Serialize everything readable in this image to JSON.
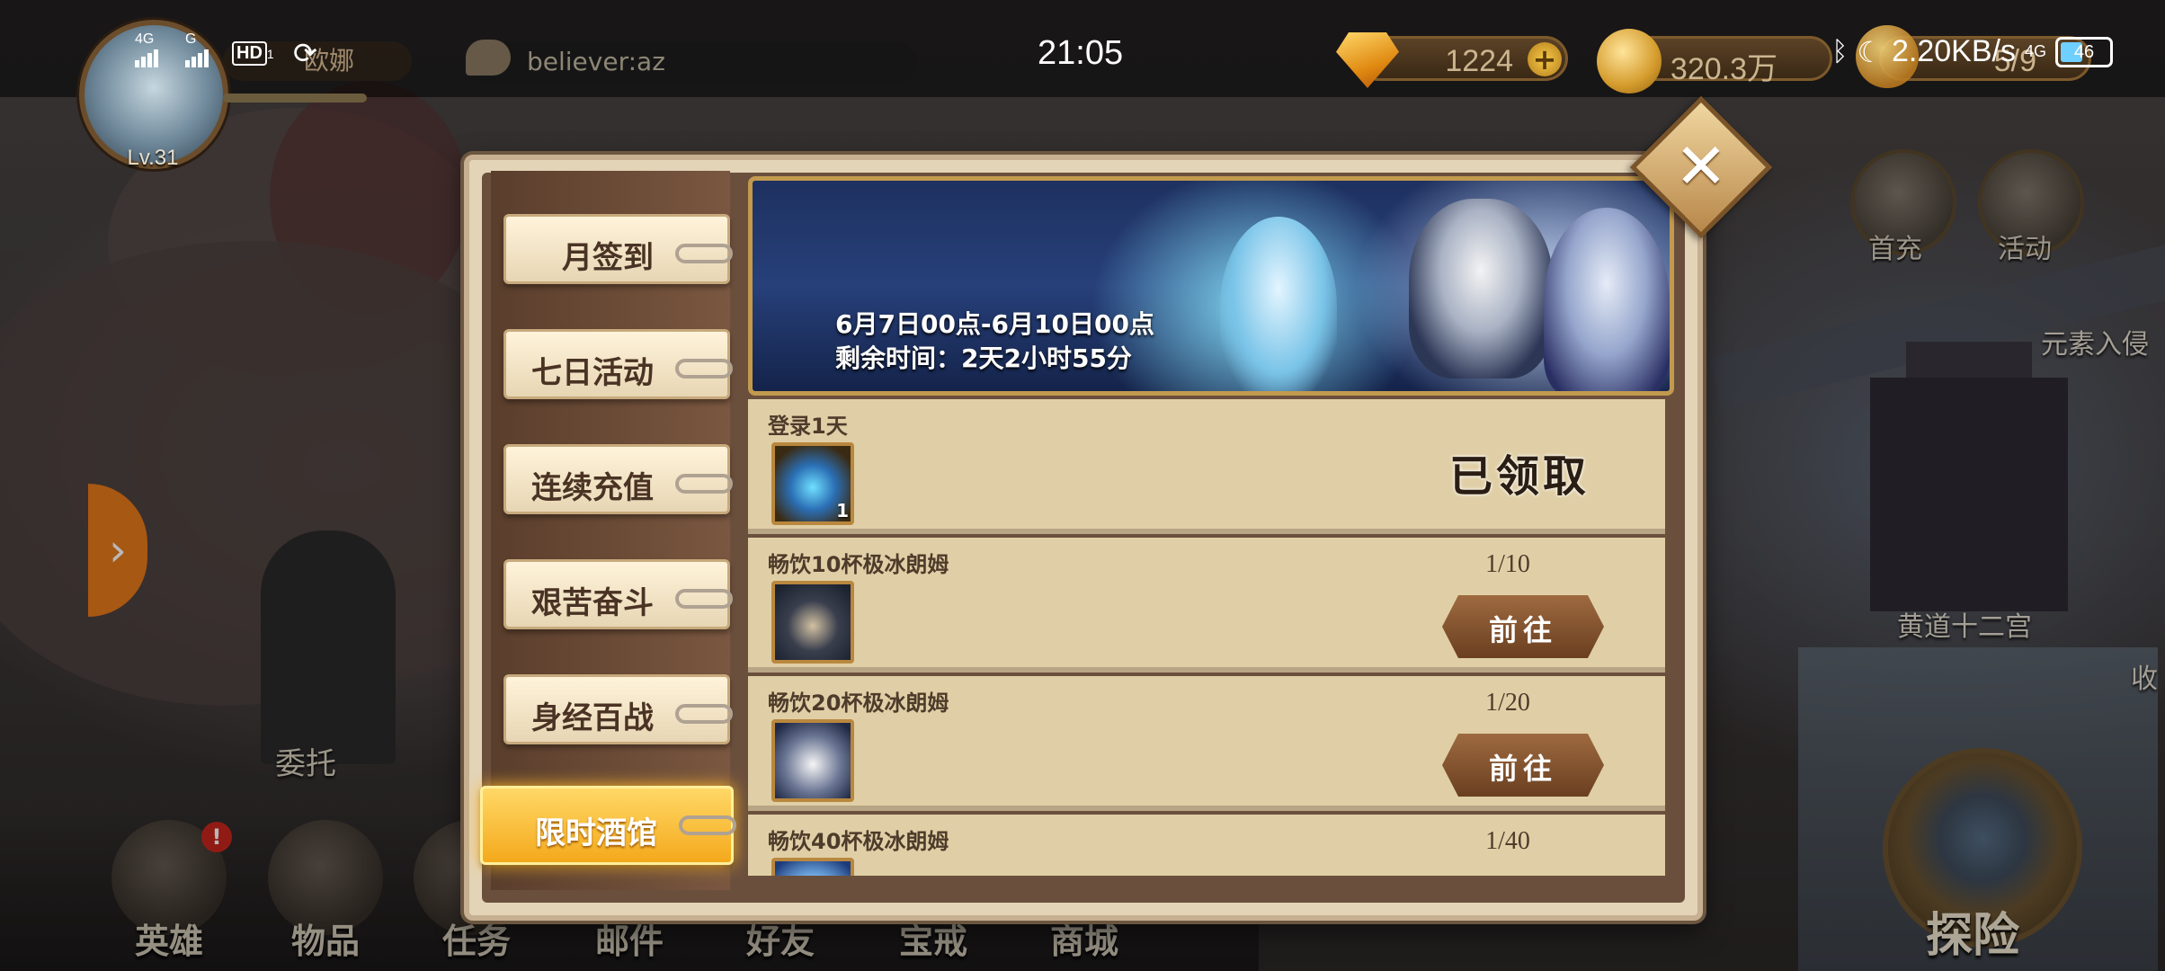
{
  "status_bar": {
    "net1": "4G",
    "net2": "G",
    "hd": "HD",
    "hd_sub": "1",
    "time": "21:05",
    "network_speed": "2.20KB/s",
    "net3": "4G",
    "battery": "46"
  },
  "player": {
    "level": "Lv.31",
    "name": "欧娜",
    "chat_text": "believer:az"
  },
  "currencies": {
    "gems": "1224",
    "gold": "320.3万",
    "stamina": "5/9"
  },
  "side": {
    "first_charge": "首充",
    "activity": "活动",
    "element_invasion": "元素入侵",
    "zodiac": "黄道十二宫",
    "collect": "收",
    "commission": "委托",
    "expedition": "探险"
  },
  "bottom_nav": [
    "英雄",
    "物品",
    "任务",
    "邮件",
    "好友",
    "宝戒",
    "商城"
  ],
  "hero_badge": "!",
  "tabs": [
    {
      "label": "月签到",
      "active": false
    },
    {
      "label": "七日活动",
      "active": false
    },
    {
      "label": "连续充值",
      "active": false
    },
    {
      "label": "艰苦奋斗",
      "active": false
    },
    {
      "label": "身经百战",
      "active": false
    },
    {
      "label": "限时酒馆",
      "active": true
    }
  ],
  "banner": {
    "date_range": "6月7日00点-6月10日00点",
    "remaining": "剩余时间：2天2小时55分"
  },
  "tasks": [
    {
      "name": "登录1天",
      "item_qty": "1",
      "status": "已领取",
      "progress": "",
      "button": ""
    },
    {
      "name": "畅饮10杯极冰朗姆",
      "item_qty": "",
      "status": "",
      "progress": "1/10",
      "button": "前往"
    },
    {
      "name": "畅饮20杯极冰朗姆",
      "item_qty": "",
      "status": "",
      "progress": "1/20",
      "button": "前往"
    },
    {
      "name": "畅饮40杯极冰朗姆",
      "item_qty": "",
      "status": "",
      "progress": "1/40",
      "button": ""
    }
  ],
  "close_label": "✕",
  "arrow_label": "›"
}
